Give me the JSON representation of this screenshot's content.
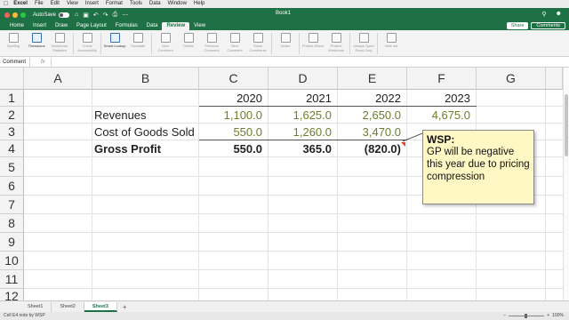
{
  "menubar": {
    "app": "Excel",
    "items": [
      "File",
      "Edit",
      "View",
      "Insert",
      "Format",
      "Tools",
      "Data",
      "Window",
      "Help"
    ]
  },
  "titlebar": {
    "autosave_label": "AutoSave",
    "toggle_state": "OFF",
    "book_title": "Book1"
  },
  "ribbon_tabs": [
    "Home",
    "Insert",
    "Draw",
    "Page Layout",
    "Formulas",
    "Data",
    "Review",
    "View"
  ],
  "active_tab": "Review",
  "share_label": "Share",
  "comments_label": "Comments",
  "ribbon_buttons": [
    {
      "label": "Spelling",
      "enabled": false
    },
    {
      "label": "Thesaurus",
      "enabled": true
    },
    {
      "label": "Workbook Statistics",
      "enabled": false
    },
    {
      "label": "Check Accessibility",
      "enabled": false
    },
    {
      "label": "Smart Lookup",
      "enabled": true
    },
    {
      "label": "Translate",
      "enabled": false
    },
    {
      "label": "New Comment",
      "enabled": false
    },
    {
      "label": "Delete",
      "enabled": false
    },
    {
      "label": "Previous Comment",
      "enabled": false
    },
    {
      "label": "Next Comment",
      "enabled": false
    },
    {
      "label": "Show Comments",
      "enabled": false
    },
    {
      "label": "Notes",
      "enabled": false
    },
    {
      "label": "Protect Sheet",
      "enabled": false
    },
    {
      "label": "Protect Workbook",
      "enabled": false
    },
    {
      "label": "Always Open Read-Only",
      "enabled": false
    },
    {
      "label": "Hide Ink",
      "enabled": false
    }
  ],
  "formula_bar": {
    "name_box": "Comment",
    "fx": "fx"
  },
  "columns": [
    "A",
    "B",
    "C",
    "D",
    "E",
    "F",
    "G"
  ],
  "rows": [
    "1",
    "2",
    "3",
    "4",
    "5",
    "6",
    "7",
    "8",
    "9",
    "10",
    "11",
    "12"
  ],
  "table": {
    "years": [
      "2020",
      "2021",
      "2022",
      "2023"
    ],
    "revenues": {
      "label": "Revenues",
      "values": [
        "1,100.0",
        "1,625.0",
        "2,650.0",
        "4,675.0"
      ]
    },
    "cogs": {
      "label": "Cost of Goods Sold",
      "values": [
        "550.0",
        "1,260.0",
        "3,470.0"
      ]
    },
    "gross_profit": {
      "label": "Gross Profit",
      "values": [
        "550.0",
        "365.0",
        "(820.0)"
      ]
    }
  },
  "note": {
    "author": "WSP:",
    "text": "GP will be negative this year due to pricing compression"
  },
  "sheets": [
    "Sheet1",
    "Sheet2",
    "Sheet3"
  ],
  "active_sheet": "Sheet3",
  "add_sheet": "+",
  "status": {
    "message": "Cell E4 note by WSP",
    "zoom": "100%"
  },
  "colors": {
    "excel_green": "#1e7145",
    "input_text": "#6b7f2d",
    "note_bg": "#fff8c5",
    "note_indicator": "#e8392a"
  }
}
